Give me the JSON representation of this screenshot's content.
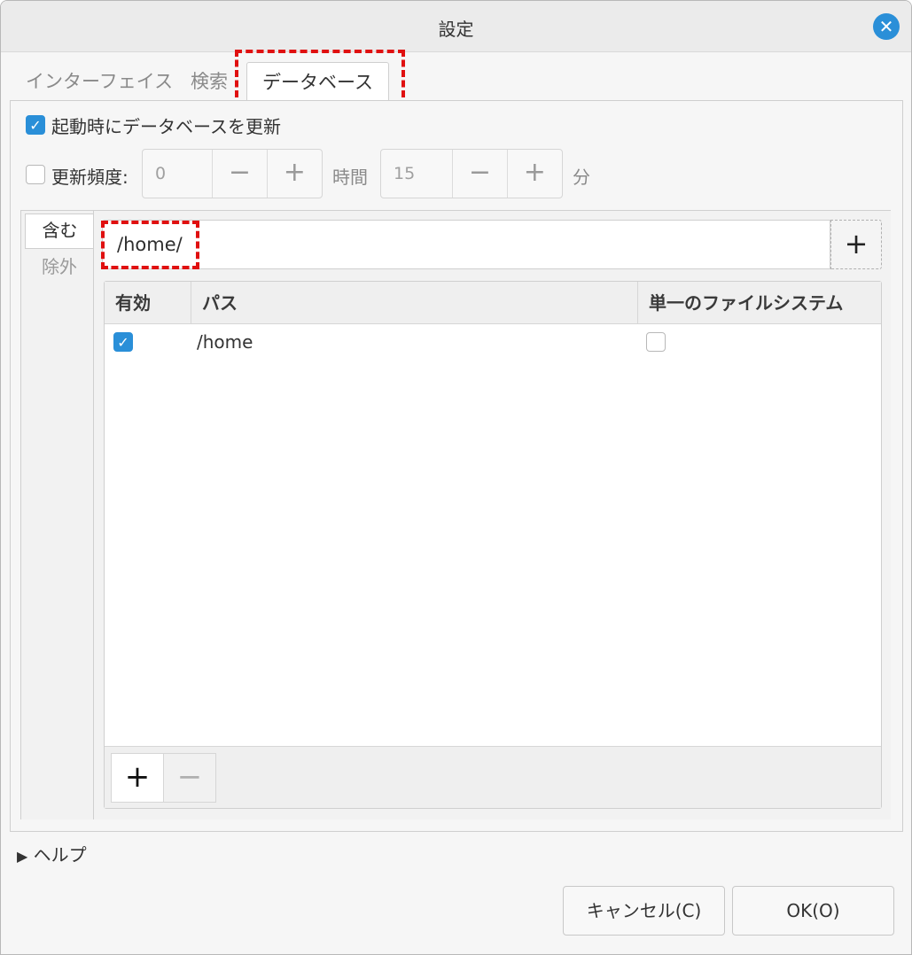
{
  "window": {
    "title": "設定",
    "close_icon": "close-icon"
  },
  "tabs": [
    {
      "label": "インターフェイス",
      "active": false
    },
    {
      "label": "検索",
      "active": false
    },
    {
      "label": "データベース",
      "active": true
    }
  ],
  "options": {
    "update_on_start_label": "起動時にデータベースを更新",
    "update_on_start_checked": true,
    "update_freq_label": "更新頻度:",
    "update_freq_checked": false,
    "hours_value": "0",
    "hours_unit": "時間",
    "minutes_value": "15",
    "minutes_unit": "分",
    "minus_symbol": "−",
    "plus_symbol": "+"
  },
  "side_tabs": [
    {
      "label": "含む",
      "active": true
    },
    {
      "label": "除外",
      "active": false
    }
  ],
  "path_entry": {
    "value": "/home/",
    "add_button": "+"
  },
  "table": {
    "columns": [
      "有効",
      "パス",
      "単一のファイルシステム"
    ],
    "rows": [
      {
        "enabled": true,
        "path": "/home",
        "single_fs": false
      }
    ],
    "add_button": "+",
    "remove_button": "−"
  },
  "help": {
    "label": "ヘルプ"
  },
  "buttons": {
    "cancel": "キャンセル(C)",
    "ok": "OK(O)"
  },
  "colors": {
    "accent": "#2a8fd8",
    "highlight": "#e01010"
  }
}
